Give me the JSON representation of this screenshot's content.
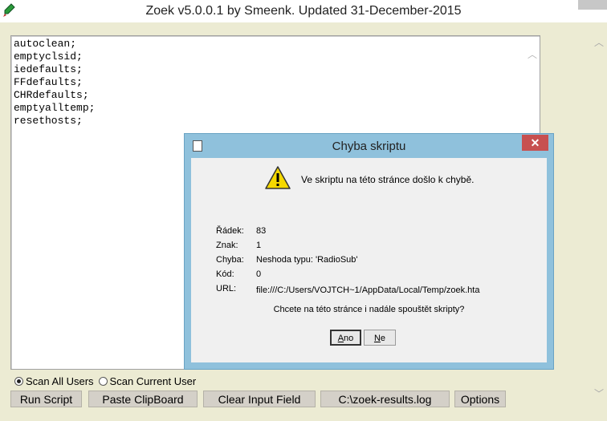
{
  "window": {
    "title": "Zoek v5.0.0.1 by Smeenk. Updated 31-December-2015",
    "icon": "pen-icon"
  },
  "editor": {
    "lines": [
      "autoclean;",
      "emptyclsid;",
      "iedefaults;",
      "FFdefaults;",
      "CHRdefaults;",
      "emptyalltemp;",
      "resethosts;"
    ]
  },
  "scan_options": {
    "all_users": "Scan All Users",
    "current_user": "Scan Current User",
    "selected": "all_users"
  },
  "buttons": {
    "run_script": "Run Script",
    "paste_clipboard": "Paste ClipBoard",
    "clear_input": "Clear Input Field",
    "results": "C:\\zoek-results.log",
    "options": "Options"
  },
  "dialog": {
    "title": "Chyba skriptu",
    "close": "✕",
    "message": "Ve skriptu na této stránce došlo k chybě.",
    "fields": [
      {
        "label": "Řádek:",
        "value": "83"
      },
      {
        "label": "Znak:",
        "value": "1"
      },
      {
        "label": "Chyba:",
        "value": "Neshoda typu: 'RadioSub'"
      },
      {
        "label": "Kód:",
        "value": "0"
      },
      {
        "label": "URL:",
        "value": "file:///C:/Users/VOJTCH~1/AppData/Local/Temp/zoek.hta"
      }
    ],
    "question": "Chcete na této stránce i nadále spouštět skripty?",
    "yes_first": "A",
    "yes_rest": "no",
    "no_first": "N",
    "no_rest": "e"
  },
  "colors": {
    "dialog_frame": "#8fc1dc",
    "close_button": "#c75050",
    "background": "#ecebd3"
  }
}
